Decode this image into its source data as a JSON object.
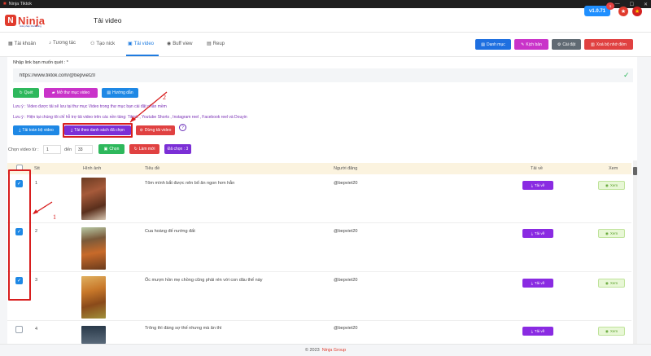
{
  "window": {
    "title": "Ninja Tiktok",
    "controls": [
      "—",
      "☐",
      "✕"
    ]
  },
  "header": {
    "logo_text": "Ninja",
    "logo_tagline": "Giải pháp Marketing",
    "page_title": "Tải video",
    "version": "v1.0.71",
    "notif_count": "1"
  },
  "tabs": [
    {
      "label": "Tài khoản",
      "icon": "grid-icon"
    },
    {
      "label": "Tương tác",
      "icon": "tiktok-icon"
    },
    {
      "label": "Tạo nick",
      "icon": "user-plus-icon"
    },
    {
      "label": "Tải video",
      "icon": "save-icon"
    },
    {
      "label": "Buff view",
      "icon": "eye-icon"
    },
    {
      "label": "Reup",
      "icon": "file-icon"
    }
  ],
  "top_buttons": [
    {
      "label": "Danh mục",
      "color": "#1e6fe0"
    },
    {
      "label": "Kịch bản",
      "color": "#c933c9"
    },
    {
      "label": "Cài đặt",
      "color": "#606a73"
    },
    {
      "label": "Xoá bộ nhớ đệm",
      "color": "#e04141"
    }
  ],
  "form": {
    "url_label": "Nhập link bạn muốn quét : *",
    "url_value": "https://www.tiktok.com/@bepviet20",
    "btn_scan": "Quét",
    "btn_open_folder": "Mở thư mục video",
    "btn_guide": "Hướng dẫn",
    "note1": "Lưu ý : Video được tải sẽ lưu tại thư mục Video trong thư mục bạn cài đặt phần mềm",
    "note2": "Lưu ý : Hiện tại chúng tôi chỉ hỗ trợ tải video trên các nền tảng: Tiktok , Youtube Shorts , Instagram reel , Facebook reel và Douyin",
    "btn_download_all": "Tải toàn bộ video",
    "btn_download_selected": "Tải theo danh sách đã chọn",
    "btn_stop": "Dừng tải video",
    "help": "?",
    "select_from_label": "Chọn video từ :",
    "select_from": "1",
    "to_label": "đến",
    "select_to": "33",
    "btn_select": "Chọn",
    "btn_refresh": "Làm mới",
    "selected_badge": "Đã chọn : 3"
  },
  "table": {
    "headers": [
      "Stt",
      "Hình ảnh",
      "Tiêu đề",
      "Người đăng",
      "Tải về",
      "Xem"
    ],
    "rows": [
      {
        "stt": "1",
        "title": "Tôm mình bắt được nên bổ ăn ngon hơn hẳn",
        "author": "@bepviet20",
        "checked": true
      },
      {
        "stt": "2",
        "title": "Cua hoàng đế nướng đất",
        "author": "@bepviet20",
        "checked": true
      },
      {
        "stt": "3",
        "title": "Ốc mượn hồn mẹ chồng cũng phải rén với con dâu thế này",
        "author": "@bepviet20",
        "checked": true
      },
      {
        "stt": "4",
        "title": "Trông thì đáng sợ thế nhưng mà ăn thì",
        "author": "@bepviet20",
        "checked": false
      }
    ],
    "download_label": "Tải về",
    "view_label": "Xem"
  },
  "annotations": {
    "label1": "1",
    "label2": "2"
  },
  "footer": {
    "copyright": "© 2023",
    "brand": "Ninja Group"
  }
}
